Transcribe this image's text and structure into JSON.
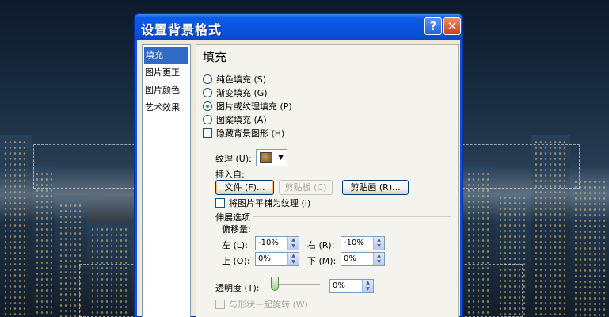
{
  "dialog": {
    "title": "设置背景格式",
    "help_button": "?",
    "close_button": "✕"
  },
  "nav": {
    "items": [
      {
        "label": "填充",
        "selected": true
      },
      {
        "label": "图片更正",
        "selected": false
      },
      {
        "label": "图片颜色",
        "selected": false
      },
      {
        "label": "艺术效果",
        "selected": false
      }
    ]
  },
  "fill": {
    "section_title": "填充",
    "options": [
      {
        "label": "纯色填充 (S)",
        "checked": false
      },
      {
        "label": "渐变填充 (G)",
        "checked": false
      },
      {
        "label": "图片或纹理填充 (P)",
        "checked": true
      },
      {
        "label": "图案填充 (A)",
        "checked": false
      }
    ],
    "hide_bg_graphics": "隐藏背景图形 (H)",
    "texture_label": "纹理 (U):",
    "insert_from_label": "插入自:",
    "file_button": "文件 (F)...",
    "clipboard_button": "剪贴板 (C)",
    "clipart_button": "剪贴画 (R)...",
    "tile_checkbox": "将图片平铺为纹理 (I)",
    "stretch_group": "伸展选项",
    "offset_label": "偏移量:",
    "offsets": {
      "left_label": "左 (L):",
      "left_value": "-10%",
      "right_label": "右 (R):",
      "right_value": "-10%",
      "top_label": "上 (O):",
      "top_value": "0%",
      "bottom_label": "下 (M):",
      "bottom_value": "0%"
    },
    "transparency_label": "透明度 (T):",
    "transparency_value": "0%",
    "transparency_level": 0,
    "rotate_with_shape": "与形状一起旋转 (W)"
  }
}
